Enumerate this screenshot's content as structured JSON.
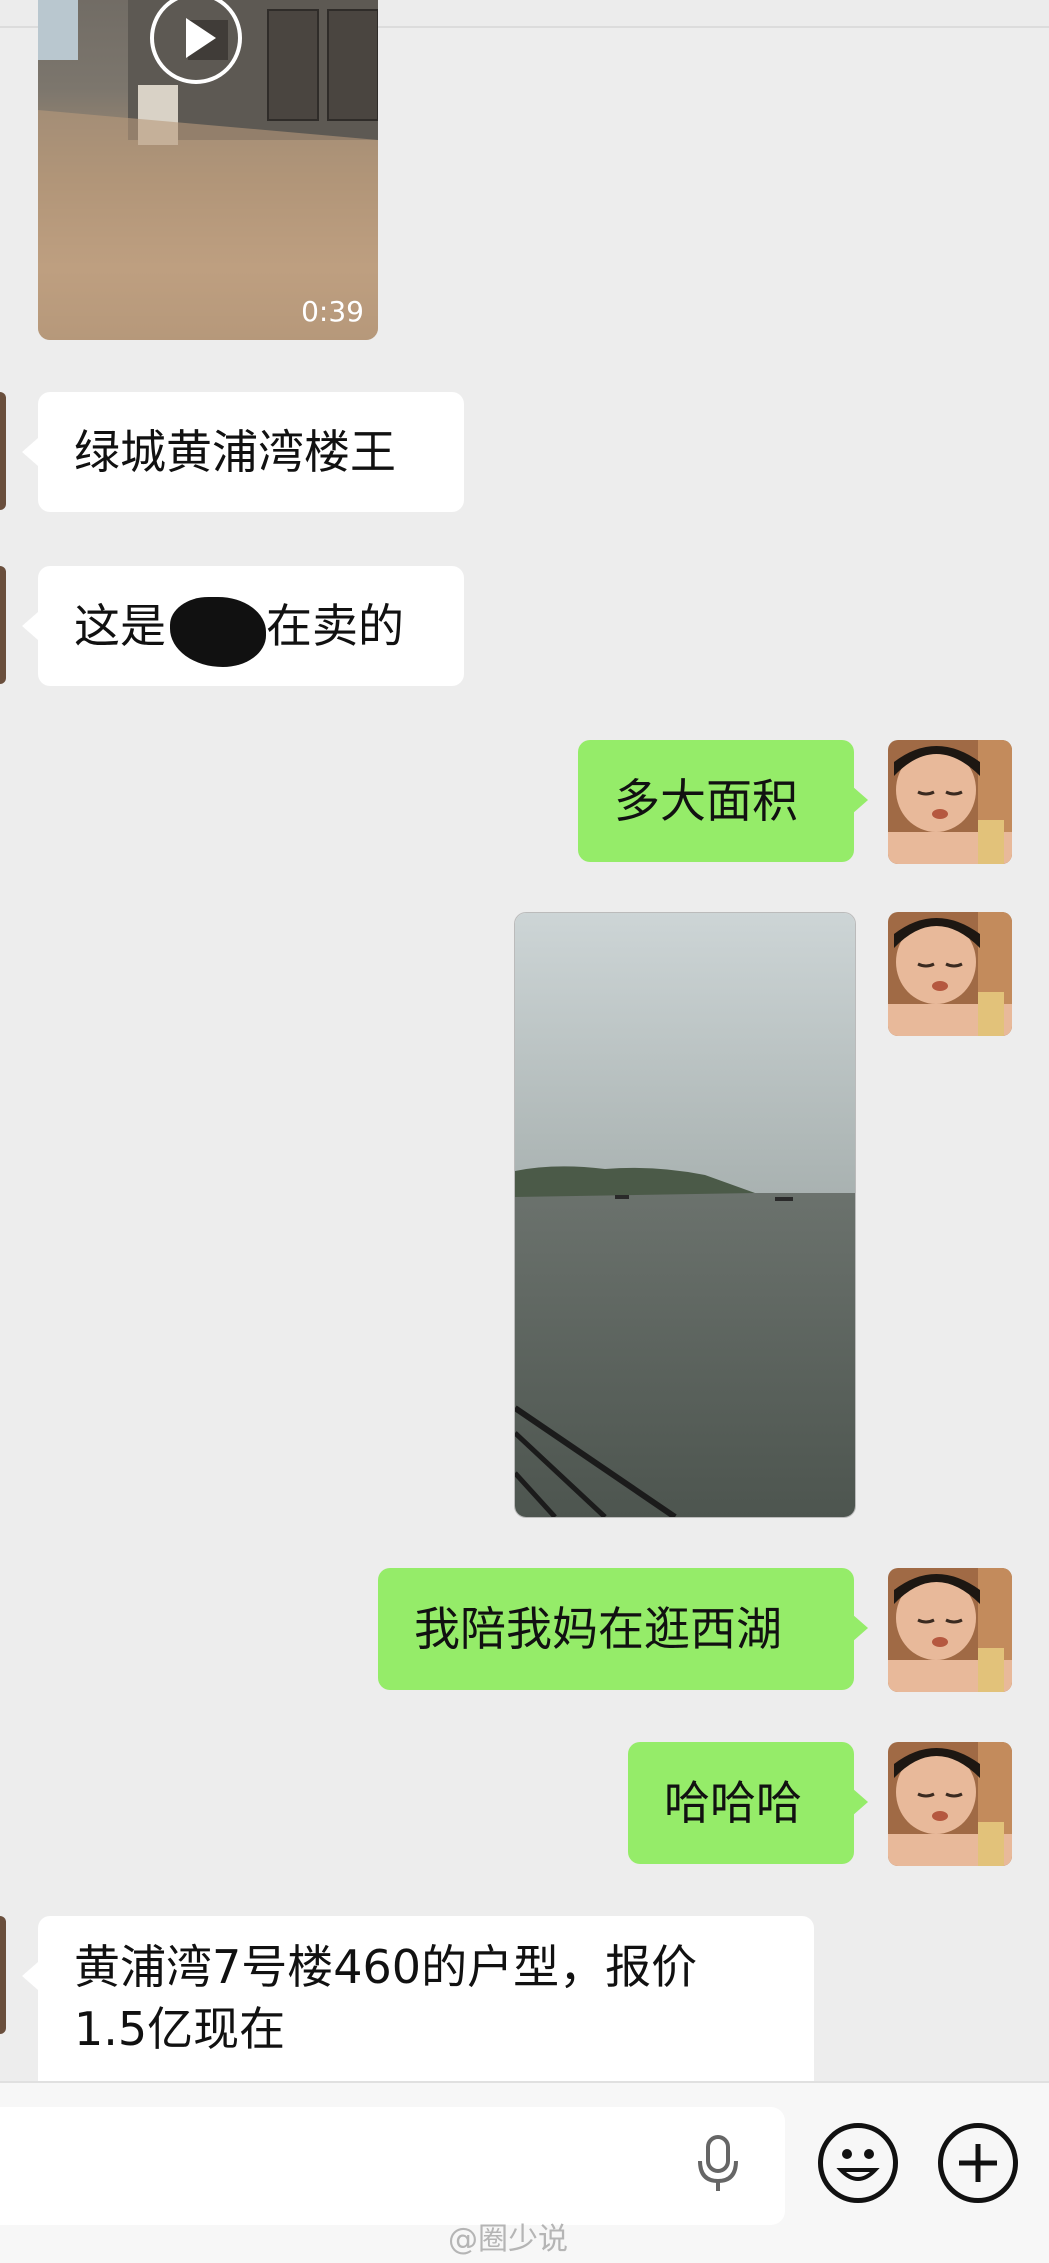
{
  "messages": [
    {
      "type": "video",
      "side": "left",
      "duration": "0:39"
    },
    {
      "type": "text",
      "side": "left",
      "text": "绿城黄浦湾楼王"
    },
    {
      "type": "text",
      "side": "left",
      "text_before": "这是",
      "text_after": "在卖的",
      "redacted": true
    },
    {
      "type": "text",
      "side": "right",
      "text": "多大面积"
    },
    {
      "type": "video",
      "side": "right"
    },
    {
      "type": "text",
      "side": "right",
      "text": "我陪我妈在逛西湖"
    },
    {
      "type": "text",
      "side": "right",
      "text": "哈哈哈"
    },
    {
      "type": "text",
      "side": "left",
      "line1": "黄浦湾7号楼460的户型，报价",
      "line2": "1.5亿现在"
    }
  ],
  "input_bar": {
    "voice_icon": "microphone-icon",
    "emoji_icon": "smiley-icon",
    "more_icon": "plus-icon"
  },
  "watermark": "@圈少说",
  "colors": {
    "incoming": "#ffffff",
    "outgoing": "#95ec69",
    "background": "#ededed"
  }
}
